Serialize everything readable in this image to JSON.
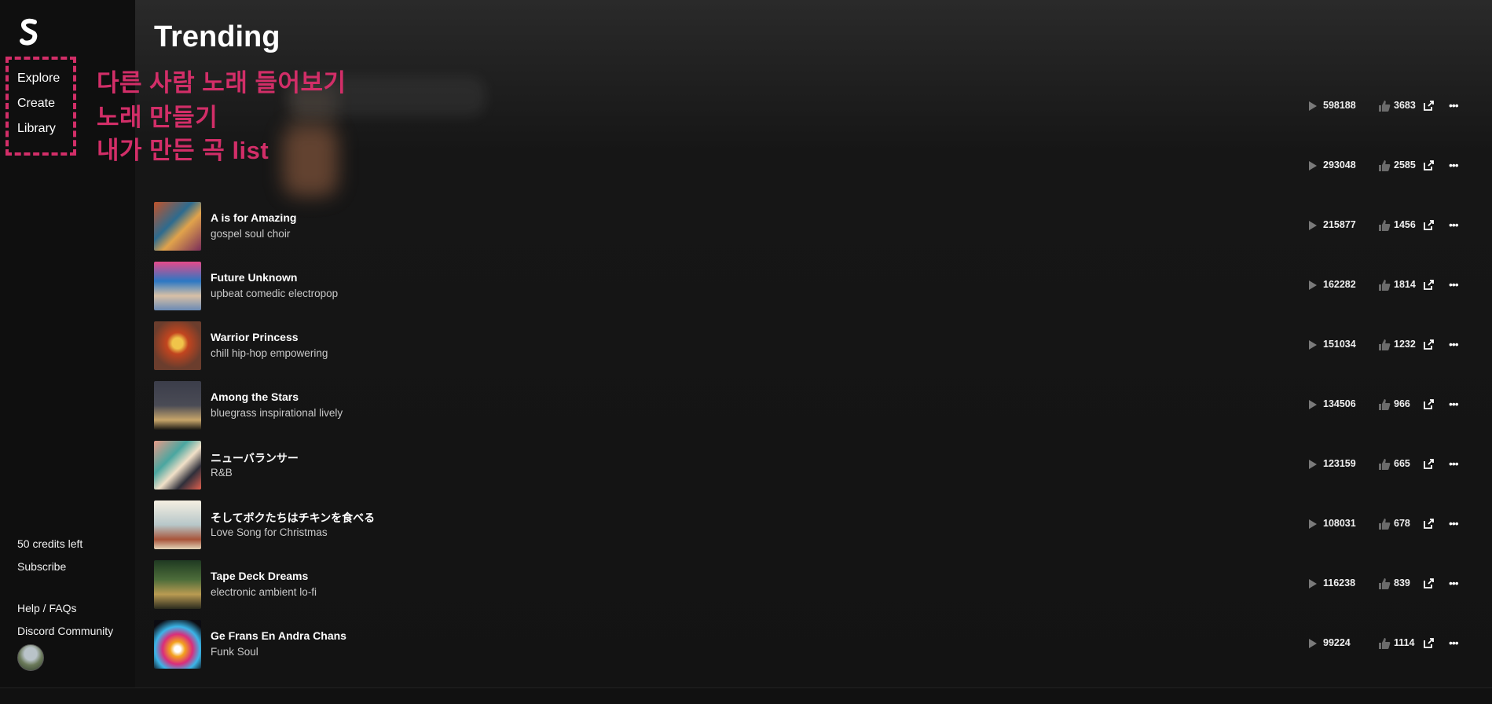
{
  "sidebar": {
    "nav": [
      {
        "label": "Explore"
      },
      {
        "label": "Create"
      },
      {
        "label": "Library"
      }
    ],
    "credits": "50 credits left",
    "subscribe": "Subscribe",
    "help": "Help / FAQs",
    "discord": "Discord Community"
  },
  "annotations": [
    "다른 사람 노래 들어보기",
    "노래 만들기",
    "내가 만든 곡 list"
  ],
  "page": {
    "title": "Trending"
  },
  "tracks": [
    {
      "title": "",
      "tags": "",
      "plays": "598188",
      "likes": "3683"
    },
    {
      "title": "",
      "tags": "",
      "plays": "293048",
      "likes": "2585"
    },
    {
      "title": "A is for Amazing",
      "tags": "gospel soul choir",
      "plays": "215877",
      "likes": "1456"
    },
    {
      "title": "Future Unknown",
      "tags": "upbeat comedic electropop",
      "plays": "162282",
      "likes": "1814"
    },
    {
      "title": "Warrior Princess",
      "tags": "chill hip-hop empowering",
      "plays": "151034",
      "likes": "1232"
    },
    {
      "title": "Among the Stars",
      "tags": "bluegrass inspirational lively",
      "plays": "134506",
      "likes": "966"
    },
    {
      "title": "ニューバランサー",
      "tags": "R&B",
      "plays": "123159",
      "likes": "665"
    },
    {
      "title": "そしてボクたちはチキンを食べる",
      "tags": "Love Song for Christmas",
      "plays": "108031",
      "likes": "678"
    },
    {
      "title": "Tape Deck Dreams",
      "tags": "electronic ambient lo-fi",
      "plays": "116238",
      "likes": "839"
    },
    {
      "title": "Ge Frans En Andra Chans",
      "tags": "Funk Soul",
      "plays": "99224",
      "likes": "1114"
    }
  ],
  "colors": {
    "accent": "#d22e68",
    "background": "#131313",
    "sidebar": "#0f0f0f"
  }
}
